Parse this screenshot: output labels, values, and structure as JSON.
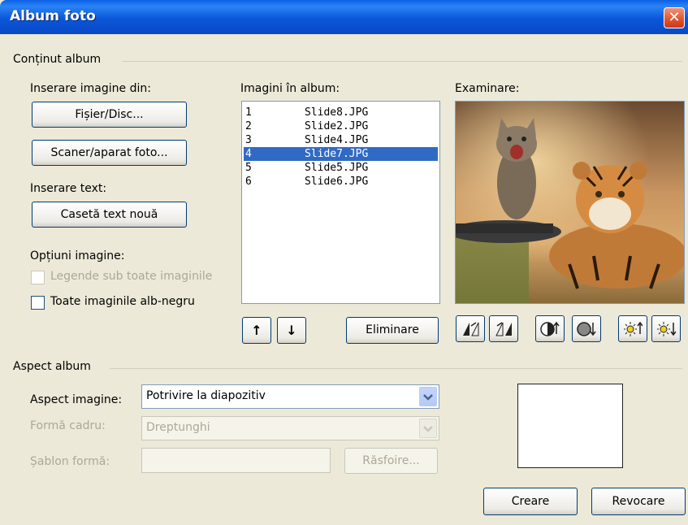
{
  "window": {
    "title": "Album foto"
  },
  "content_group": {
    "label": "Conținut album",
    "insert_from_label": "Inserare imagine din:",
    "file_button": "Fișier/Disc...",
    "scanner_button": "Scaner/aparat foto...",
    "insert_text_label": "Inserare text:",
    "new_textbox_button": "Casetă text nouă",
    "image_options_label": "Opțiuni imagine:",
    "captions_checkbox": {
      "label": "Legende sub toate imaginile",
      "checked": false,
      "enabled": false
    },
    "bw_checkbox": {
      "label": "Toate imaginile alb-negru",
      "checked": false,
      "enabled": true
    }
  },
  "images_list": {
    "label": "Imagini în album:",
    "items": [
      {
        "num": "1",
        "file": "Slide8.JPG",
        "selected": false
      },
      {
        "num": "2",
        "file": "Slide2.JPG",
        "selected": false
      },
      {
        "num": "3",
        "file": "Slide4.JPG",
        "selected": false
      },
      {
        "num": "4",
        "file": "Slide7.JPG",
        "selected": true
      },
      {
        "num": "5",
        "file": "Slide5.JPG",
        "selected": false
      },
      {
        "num": "6",
        "file": "Slide6.JPG",
        "selected": false
      }
    ],
    "move_up_glyph": "↑",
    "move_down_glyph": "↓",
    "remove_button": "Eliminare"
  },
  "preview": {
    "label": "Examinare:",
    "toolbar_icons": [
      "rotate-left-icon",
      "rotate-right-icon",
      "contrast-up-icon",
      "contrast-down-icon",
      "brightness-up-icon",
      "brightness-down-icon"
    ]
  },
  "layout_group": {
    "label": "Aspect album",
    "picture_layout_label": "Aspect imagine:",
    "picture_layout_value": "Potrivire la diapozitiv",
    "frame_shape_label": "Formă cadru:",
    "frame_shape_value": "Dreptunghi",
    "design_template_label": "Șablon formă:",
    "design_template_value": "",
    "browse_button": "Răsfoire..."
  },
  "actions": {
    "create_button": "Creare",
    "cancel_button": "Revocare"
  },
  "colors": {
    "dialog_bg": "#ECE9D8",
    "titlebar": "#0A57D8",
    "selection": "#316AC5",
    "button_border": "#003C74",
    "disabled_text": "#ACA899"
  }
}
